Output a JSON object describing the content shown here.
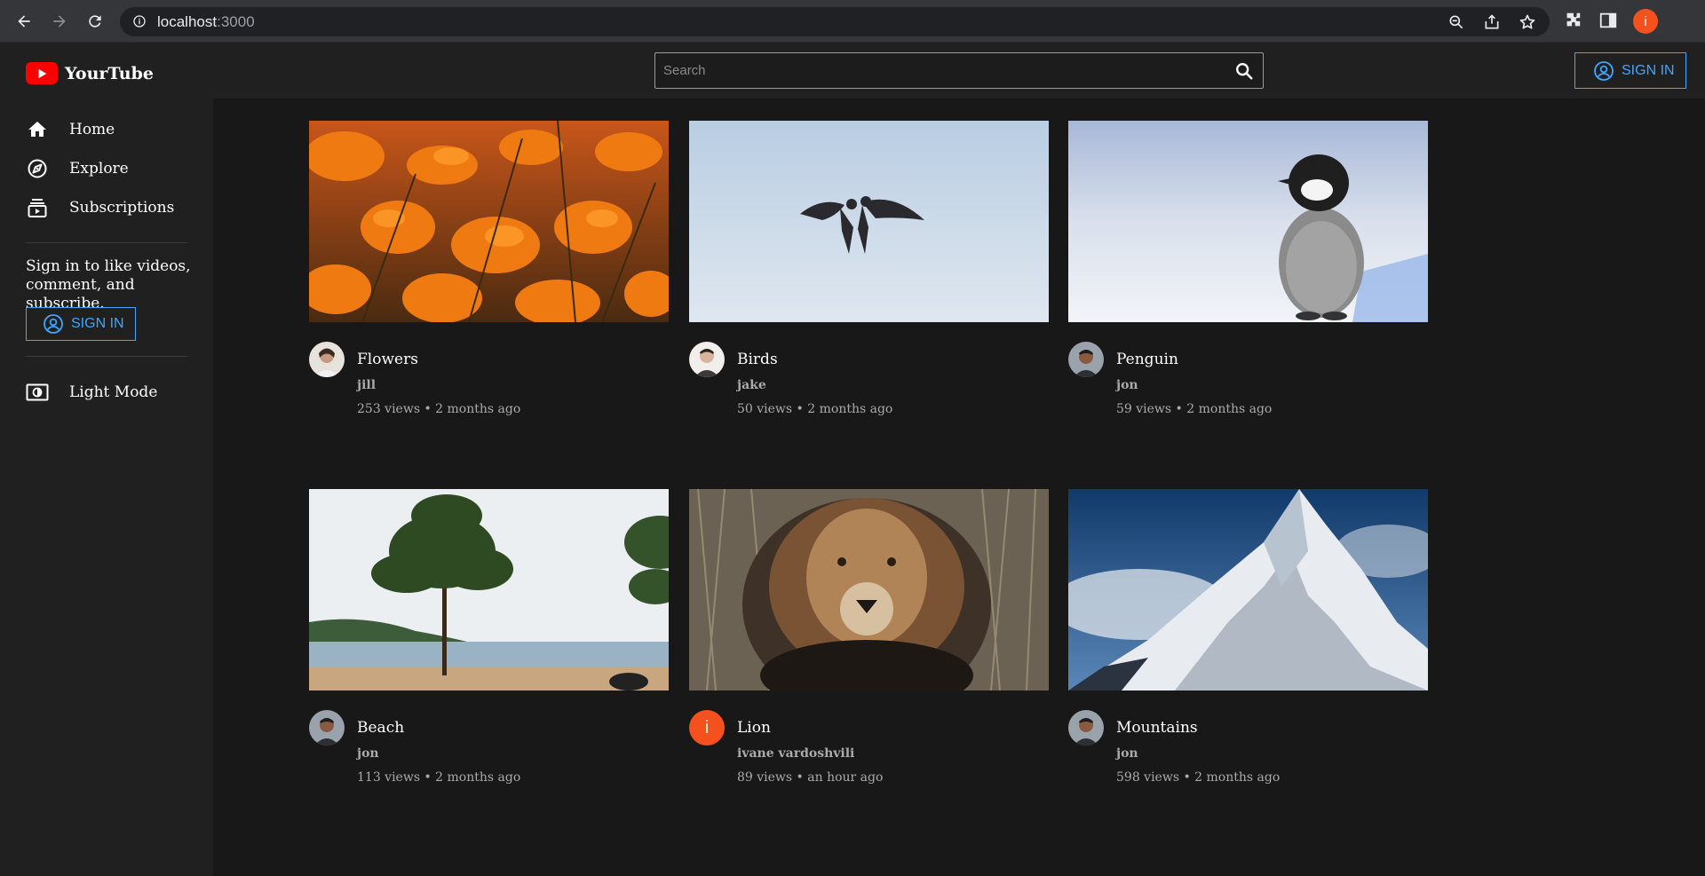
{
  "browser": {
    "url_host": "localhost",
    "url_port": ":3000",
    "profile_initial": "i"
  },
  "app": {
    "logo_text": "YourTube",
    "brand_color": "#ff0000",
    "accent_color": "#3ea6ff"
  },
  "search": {
    "placeholder": "Search"
  },
  "header": {
    "signin_label": "SIGN IN"
  },
  "sidebar": {
    "items": [
      {
        "label": "Home",
        "icon": "home-icon"
      },
      {
        "label": "Explore",
        "icon": "explore-icon"
      },
      {
        "label": "Subscriptions",
        "icon": "subscriptions-icon"
      }
    ],
    "signin_prompt": "Sign in to like videos, comment, and subscribe.",
    "signin_label": "SIGN IN",
    "mode_label": "Light Mode"
  },
  "videos": [
    {
      "title": "Flowers",
      "channel": "jill",
      "meta": "253 views • 2 months ago"
    },
    {
      "title": "Birds",
      "channel": "jake",
      "meta": "50 views • 2 months ago"
    },
    {
      "title": "Penguin",
      "channel": "jon",
      "meta": "59 views • 2 months ago"
    },
    {
      "title": "Beach",
      "channel": "jon",
      "meta": "113 views • 2 months ago"
    },
    {
      "title": "Lion",
      "channel": "ivane vardoshvili",
      "meta": "89 views • an hour ago",
      "avatar_initial": "i"
    },
    {
      "title": "Mountains",
      "channel": "jon",
      "meta": "598 views • 2 months ago"
    }
  ]
}
